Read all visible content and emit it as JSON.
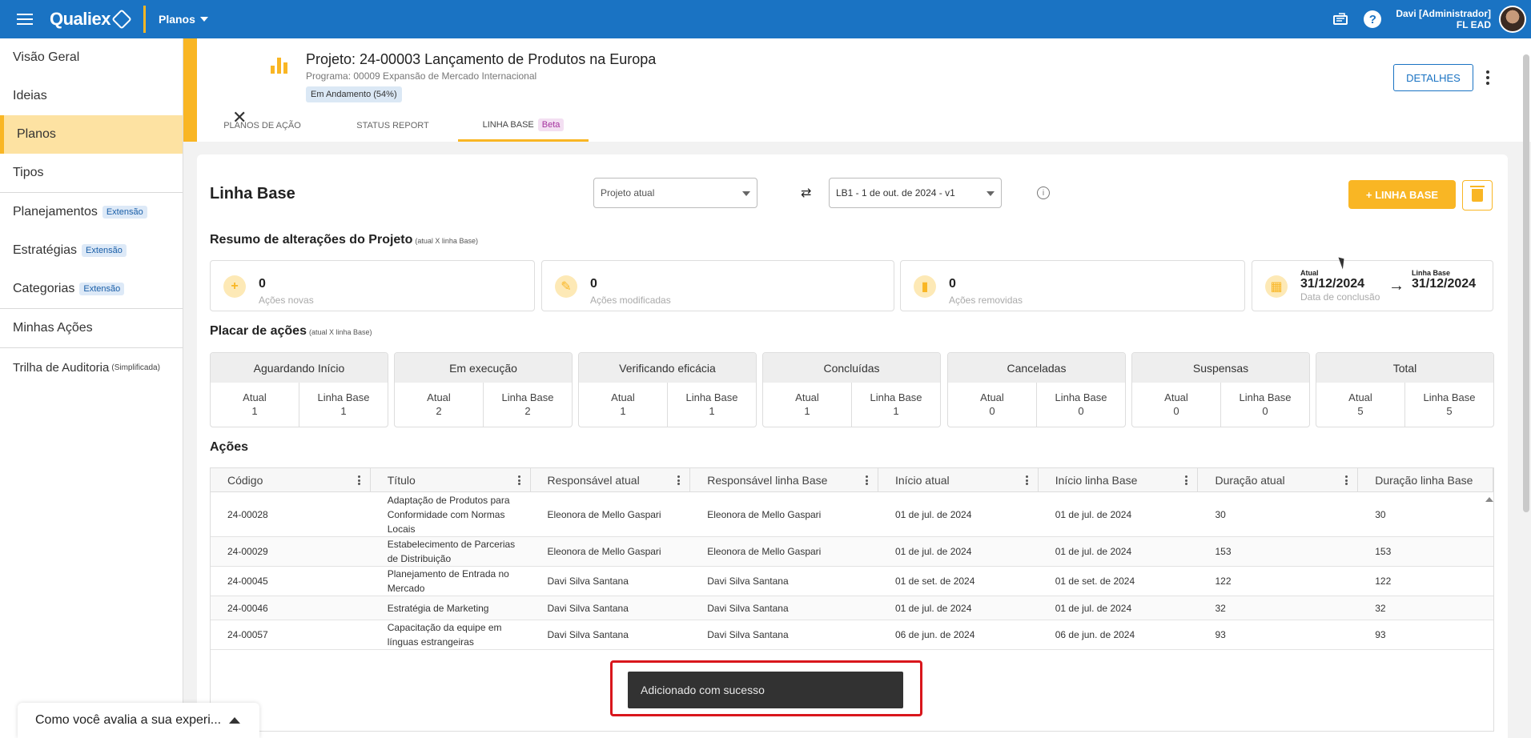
{
  "topbar": {
    "brand": "Qualiex",
    "module": "Planos",
    "user_name": "Davi [Administrador]",
    "user_org": "FL EAD"
  },
  "sidebar": {
    "items": [
      {
        "label": "Visão Geral"
      },
      {
        "label": "Ideias"
      },
      {
        "label": "Planos",
        "active": true
      },
      {
        "label": "Tipos"
      },
      {
        "label": "Planejamentos",
        "badge": "Extensão"
      },
      {
        "label": "Estratégias",
        "badge": "Extensão"
      },
      {
        "label": "Categorias",
        "badge": "Extensão"
      },
      {
        "label": "Minhas Ações"
      },
      {
        "label": "Trilha de Auditoria",
        "note": "(Simplificada)"
      }
    ]
  },
  "project": {
    "title": "Projeto: 24-00003 Lançamento de Produtos na Europa",
    "program": "Programa: 00009 Expansão de Mercado Internacional",
    "status": "Em Andamento (54%)",
    "details_label": "DETALHES",
    "tabs": [
      {
        "label": "PLANOS DE AÇÃO"
      },
      {
        "label": "STATUS REPORT"
      },
      {
        "label": "LINHA BASE",
        "badge": "Beta",
        "active": true
      }
    ]
  },
  "baseline": {
    "title": "Linha Base",
    "left_select_placeholder": "Projeto atual",
    "right_select_value": "LB1 - 1 de out. de 2024 - v1",
    "add_label": "+ LINHA BASE"
  },
  "summary": {
    "title": "Resumo de alterações do Projeto",
    "note": "(atual X linha Base)",
    "cards": [
      {
        "value": "0",
        "label": "Ações novas"
      },
      {
        "value": "0",
        "label": "Ações modificadas"
      },
      {
        "value": "0",
        "label": "Ações removidas"
      }
    ],
    "date": {
      "current_label": "Atual",
      "current_value": "31/12/2024",
      "baseline_label": "Linha Base",
      "baseline_value": "31/12/2024",
      "caption": "Data de conclusão"
    }
  },
  "scoreboard": {
    "title": "Placar de ações",
    "note": "(atual X linha Base)",
    "current_label": "Atual",
    "baseline_label": "Linha Base",
    "groups": [
      {
        "name": "Aguardando Início",
        "current": "1",
        "baseline": "1"
      },
      {
        "name": "Em execução",
        "current": "2",
        "baseline": "2"
      },
      {
        "name": "Verificando eficácia",
        "current": "1",
        "baseline": "1"
      },
      {
        "name": "Concluídas",
        "current": "1",
        "baseline": "1"
      },
      {
        "name": "Canceladas",
        "current": "0",
        "baseline": "0"
      },
      {
        "name": "Suspensas",
        "current": "0",
        "baseline": "0"
      },
      {
        "name": "Total",
        "current": "5",
        "baseline": "5"
      }
    ]
  },
  "actions": {
    "title": "Ações",
    "columns": [
      "Código",
      "Título",
      "Responsável atual",
      "Responsável linha Base",
      "Início atual",
      "Início linha Base",
      "Duração atual",
      "Duração linha Base"
    ],
    "rows": [
      [
        "24-00028",
        "Adaptação de Produtos para Conformidade com Normas Locais",
        "Eleonora de Mello Gaspari",
        "Eleonora de Mello Gaspari",
        "01 de jul. de 2024",
        "01 de jul. de 2024",
        "30",
        "30"
      ],
      [
        "24-00029",
        "Estabelecimento de Parcerias de Distribuição",
        "Eleonora de Mello Gaspari",
        "Eleonora de Mello Gaspari",
        "01 de jul. de 2024",
        "01 de jul. de 2024",
        "153",
        "153"
      ],
      [
        "24-00045",
        "Planejamento de Entrada no Mercado",
        "Davi Silva Santana",
        "Davi Silva Santana",
        "01 de set. de 2024",
        "01 de set. de 2024",
        "122",
        "122"
      ],
      [
        "24-00046",
        "Estratégia de Marketing",
        "Davi Silva Santana",
        "Davi Silva Santana",
        "01 de jul. de 2024",
        "01 de jul. de 2024",
        "32",
        "32"
      ],
      [
        "24-00057",
        "Capacitação da equipe em línguas estrangeiras",
        "Davi Silva Santana",
        "Davi Silva Santana",
        "06 de jun. de 2024",
        "06 de jun. de 2024",
        "93",
        "93"
      ]
    ]
  },
  "toast": {
    "message": "Adicionado com sucesso"
  },
  "feedback": {
    "label": "Como você avalia a sua experi..."
  }
}
